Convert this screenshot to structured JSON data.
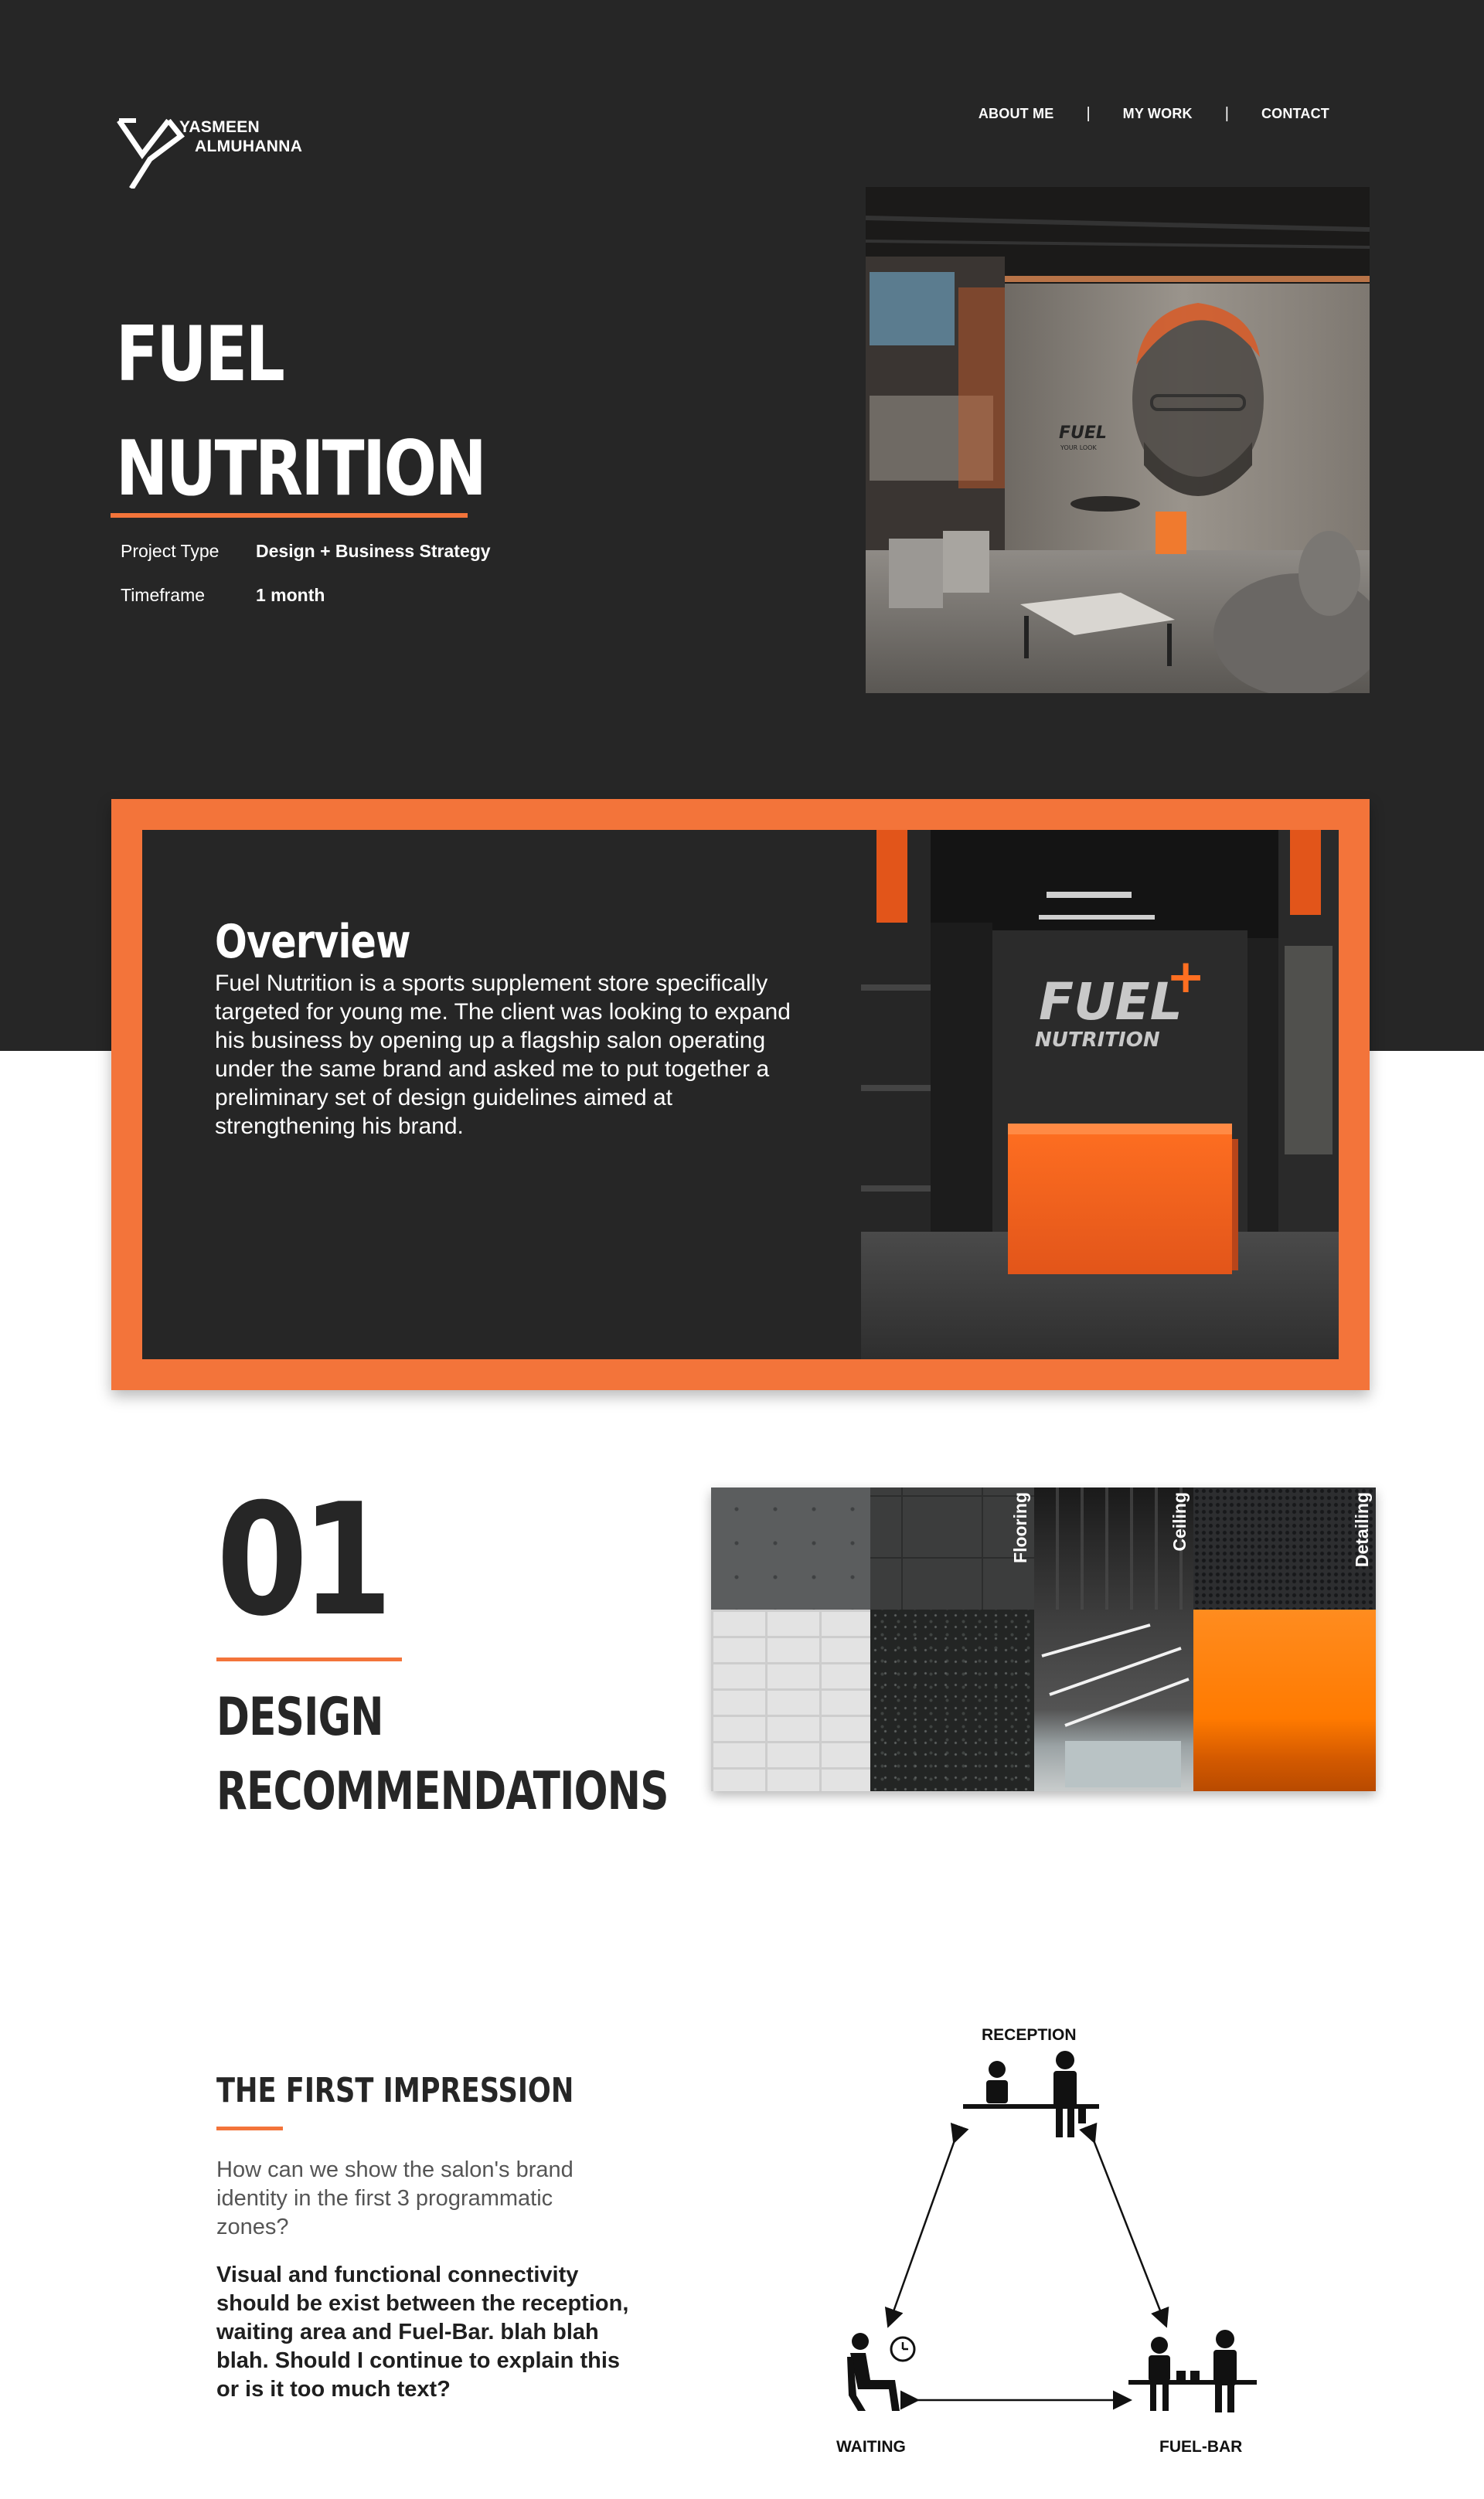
{
  "brand": {
    "first_name": "YASMEEN",
    "last_name": "ALMUHANNA"
  },
  "nav": {
    "items": [
      "ABOUT ME",
      "MY WORK",
      "CONTACT"
    ]
  },
  "hero": {
    "title_line1": "FUEL",
    "title_line2": "NUTRITION",
    "project_type_label": "Project Type",
    "project_type_value": "Design + Business Strategy",
    "timeframe_label": "Timeframe",
    "timeframe_value": "1 month",
    "image_wall_text": "FUEL",
    "image_wall_subtext": "YOUR LOOK"
  },
  "overview": {
    "title": "Overview",
    "body": "Fuel Nutrition is a sports supplement store specifically targeted for young me. The client was looking to expand his business by opening up a flagship salon operating under the same brand and asked me to put together a preliminary set of design guidelines aimed at strengthening his brand.",
    "sign_line1": "FUEL",
    "sign_line2": "NUTRITION"
  },
  "design_recommendations": {
    "number": "01",
    "heading_line1": "DESIGN",
    "heading_line2": "RECOMMENDATIONS",
    "materials": {
      "flooring": "Flooring",
      "ceiling": "Ceiling",
      "detailing": "Detailing"
    }
  },
  "first_impression": {
    "title": "THE FIRST IMPRESSION",
    "question": "How can we show the salon's brand identity in the first 3 programmatic zones?",
    "body": "Visual and functional connectivity should be exist between the reception, waiting area and Fuel-Bar.  blah blah blah. Should I continue to explain this or is it too much text?",
    "diagram": {
      "reception": "RECEPTION",
      "waiting": "WAITING",
      "fuel_bar": "FUEL-BAR"
    }
  },
  "colors": {
    "dark_bg": "#262626",
    "accent": "#f3743a",
    "white": "#ffffff"
  }
}
